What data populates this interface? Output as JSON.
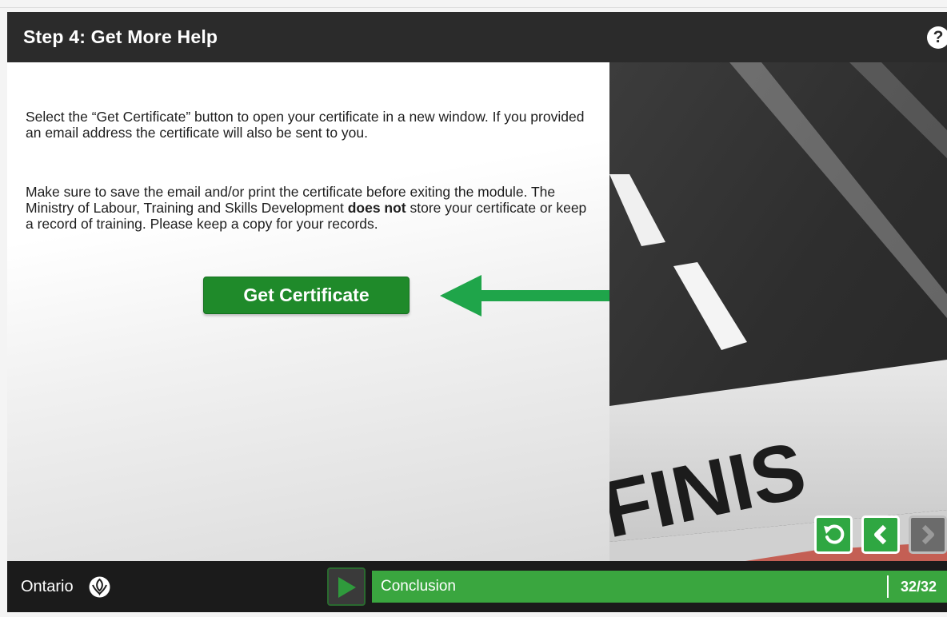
{
  "header": {
    "title": "Step 4: Get More Help",
    "help_glyph": "?"
  },
  "content": {
    "p1": "Select the “Get Certificate” button to open your certificate in a new window. If you provided an email address the certificate will also be sent to you.",
    "p2_start": "Make sure to save the email and/or print the certificate before exiting the module. The Ministry of Labour, Training and Skills Development ",
    "p2_bold": "does not",
    "p2_end": " store your certificate or keep a record of training. Please keep a copy for your records.",
    "button_label": "Get Certificate",
    "arrow_color": "#1fa54a"
  },
  "photo": {
    "text": "FINIS"
  },
  "controls": {
    "replay_icon": "replay-icon",
    "back_icon": "chevron-left-icon",
    "next_icon": "chevron-right-icon",
    "accent": "#2fa742"
  },
  "footer": {
    "brand": "Ontario",
    "chapter": "Conclusion",
    "slide_counter": "32/32",
    "progress_color": "#3aa63f"
  }
}
